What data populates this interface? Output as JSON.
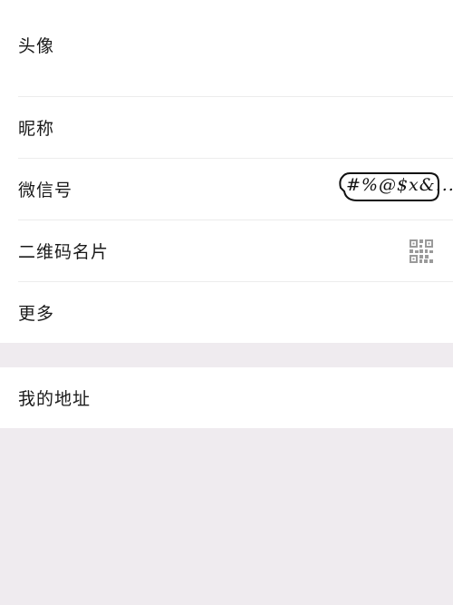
{
  "profile": {
    "avatar_label": "头像",
    "nickname_label": "昵称",
    "wechat_id_label": "微信号",
    "wechat_id_value": "#%@$x&...",
    "qr_code_label": "二维码名片",
    "more_label": "更多"
  },
  "address": {
    "label": "我的地址"
  },
  "icons": {
    "qr": "qr-code-icon"
  },
  "colors": {
    "background": "#efebef",
    "card": "#ffffff",
    "divider": "#ececec",
    "qr_icon": "#9a9a9a"
  }
}
